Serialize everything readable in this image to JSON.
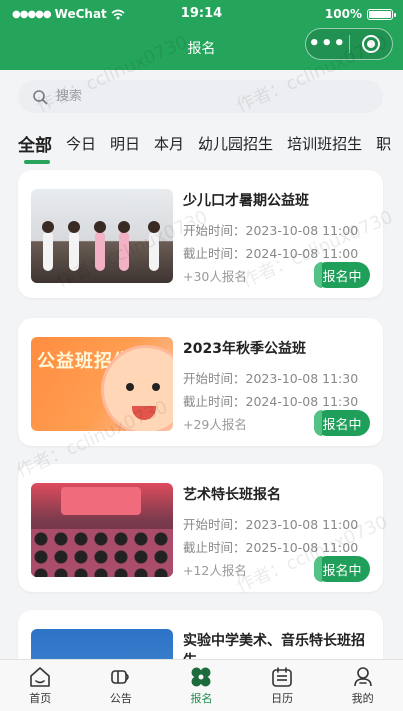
{
  "status_bar": {
    "carrier": "WeChat",
    "time": "19:14",
    "battery": "100%"
  },
  "header": {
    "title": "报名",
    "capsule_more": "•••"
  },
  "search": {
    "placeholder": "搜索"
  },
  "tabs": [
    "全部",
    "今日",
    "明日",
    "本月",
    "幼儿园招生",
    "培训班招生",
    "职"
  ],
  "activities": [
    {
      "title": "少儿口才暑期公益班",
      "start_label": "开始时间：",
      "start": "2023-10-08 11:00",
      "end_label": "截止时间：",
      "end": "2024-10-08 11:00",
      "count": "+30人报名",
      "status": "报名中"
    },
    {
      "title": "2023年秋季公益班",
      "start_label": "开始时间：",
      "start": "2023-10-08 11:30",
      "end_label": "截止时间：",
      "end": "2024-10-08 11:30",
      "count": "+29人报名",
      "status": "报名中",
      "image_text": "公益班招生"
    },
    {
      "title": "艺术特长班报名",
      "start_label": "开始时间：",
      "start": "2023-10-08 11:00",
      "end_label": "截止时间：",
      "end": "2025-10-08 11:00",
      "count": "+12人报名",
      "status": "报名中"
    },
    {
      "title": "实验中学美术、音乐特长班招生"
    }
  ],
  "tabbar": {
    "items": [
      {
        "label": "首页",
        "icon": "home-icon"
      },
      {
        "label": "公告",
        "icon": "notice-icon"
      },
      {
        "label": "报名",
        "icon": "clover-icon"
      },
      {
        "label": "日历",
        "icon": "calendar-icon"
      },
      {
        "label": "我的",
        "icon": "user-icon"
      }
    ],
    "active_index": 2
  },
  "watermark": "作者：cclinux0730",
  "colors": {
    "primary": "#25a55c",
    "badge": "#1f9f59",
    "background": "#f3f4f6"
  }
}
